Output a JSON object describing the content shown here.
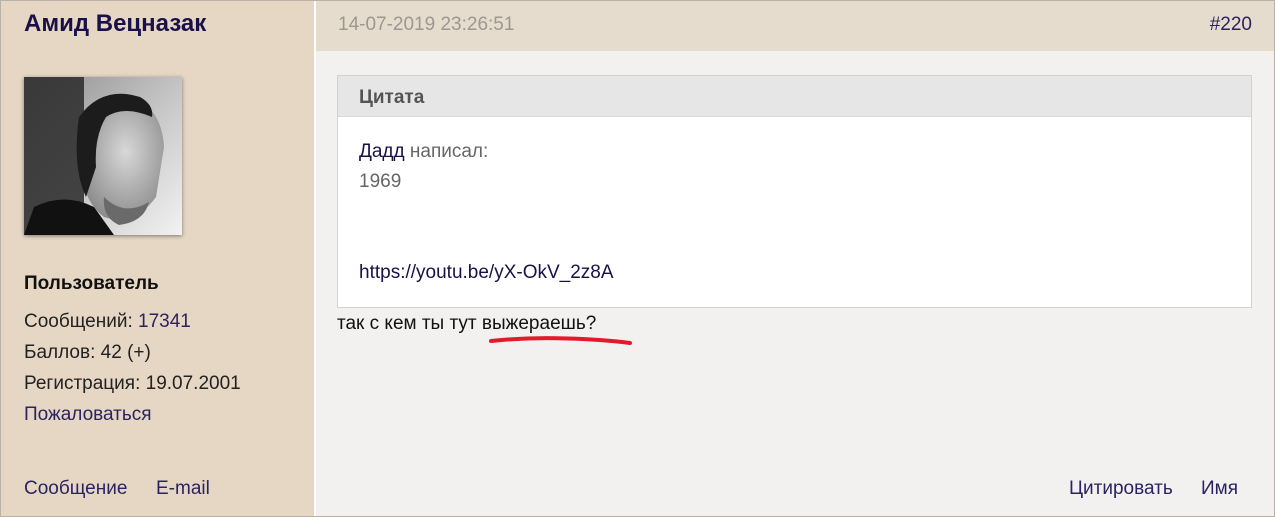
{
  "user": {
    "name": "Амид Вецназак",
    "avatar_alt": "",
    "role": "Пользователь",
    "messages_label": "Сообщений:",
    "messages_count": "17341",
    "points_label": "Баллов: 42",
    "points_plus": "(+)",
    "registration": "Регистрация: 19.07.2001",
    "report": "Пожаловаться",
    "footer_message": "Сообщение",
    "footer_email": "E-mail"
  },
  "post": {
    "timestamp": "14-07-2019 23:26:51",
    "number": "#220",
    "quote": {
      "title": "Цитата",
      "author": "Дадд",
      "wrote": "написал:",
      "line1": "1969",
      "url": "https://youtu.be/yX-OkV_2z8A"
    },
    "message_before": "так с кем ты тут ",
    "message_highlight": "выжераешь",
    "message_after": "?",
    "actions": {
      "quote": "Цитировать",
      "name": "Имя"
    }
  },
  "colors": {
    "sidebar_bg": "#e5d7c4",
    "header_bg": "#e5dccd",
    "link": "#2b2360",
    "annotation_red": "#e21b2b"
  }
}
